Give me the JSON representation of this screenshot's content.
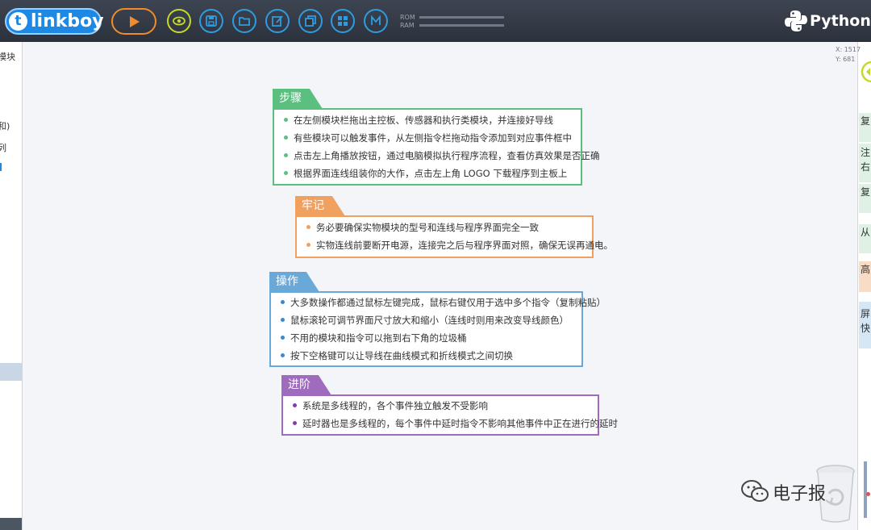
{
  "toolbar": {
    "logo_text": "linkboy",
    "logo_mark": "t",
    "memory_rom_label": "ROM",
    "memory_ram_label": "RAM",
    "language_label": "Python",
    "icons": [
      "play-icon",
      "eye-icon",
      "save-icon",
      "open-folder-icon",
      "edit-icon",
      "copy-icon",
      "grid-icon",
      "m-icon"
    ],
    "accent": "#1e88e5"
  },
  "left_panel": {
    "items": [
      "模块",
      "和)",
      "列"
    ]
  },
  "right_panel": {
    "tabs": [
      "复",
      "注",
      "右",
      "复",
      "从",
      "高",
      "屏",
      "快"
    ]
  },
  "coords": {
    "x": "X: 1517",
    "y": "Y: 681"
  },
  "cards": [
    {
      "title": "步骤",
      "color": "#5bbf80",
      "items": [
        "在左侧模块栏拖出主控板、传感器和执行类模块，并连接好导线",
        "有些模块可以触发事件，从左侧指令栏拖动指令添加到对应事件框中",
        "点击左上角播放按钮，通过电脑模拟执行程序流程，查看仿真效果是否正确",
        "根据界面连线组装你的大作，点击左上角 LOGO 下载程序到主板上"
      ]
    },
    {
      "title": "牢记",
      "color": "#f0a160",
      "items": [
        "务必要确保实物模块的型号和连线与程序界面完全一致",
        "实物连线前要断开电源，连接完之后与程序界面对照，确保无误再通电。"
      ]
    },
    {
      "title": "操作",
      "color": "#6aa8d8",
      "items": [
        "大多数操作都通过鼠标左键完成，鼠标右键仅用于选中多个指令（复制粘贴）",
        "鼠标滚轮可调节界面尺寸放大和缩小（连线时则用来改变导线颜色）",
        "不用的模块和指令可以拖到右下角的垃圾桶",
        "按下空格键可以让导线在曲线模式和折线模式之间切换"
      ]
    },
    {
      "title": "进阶",
      "color": "#9e6bbf",
      "items": [
        "系统是多线程的，各个事件独立触发不受影响",
        "延时器也是多线程的，每个事件中延时指令不影响其他事件中正在进行的延时"
      ]
    }
  ],
  "watermark": {
    "text": "电子报"
  }
}
